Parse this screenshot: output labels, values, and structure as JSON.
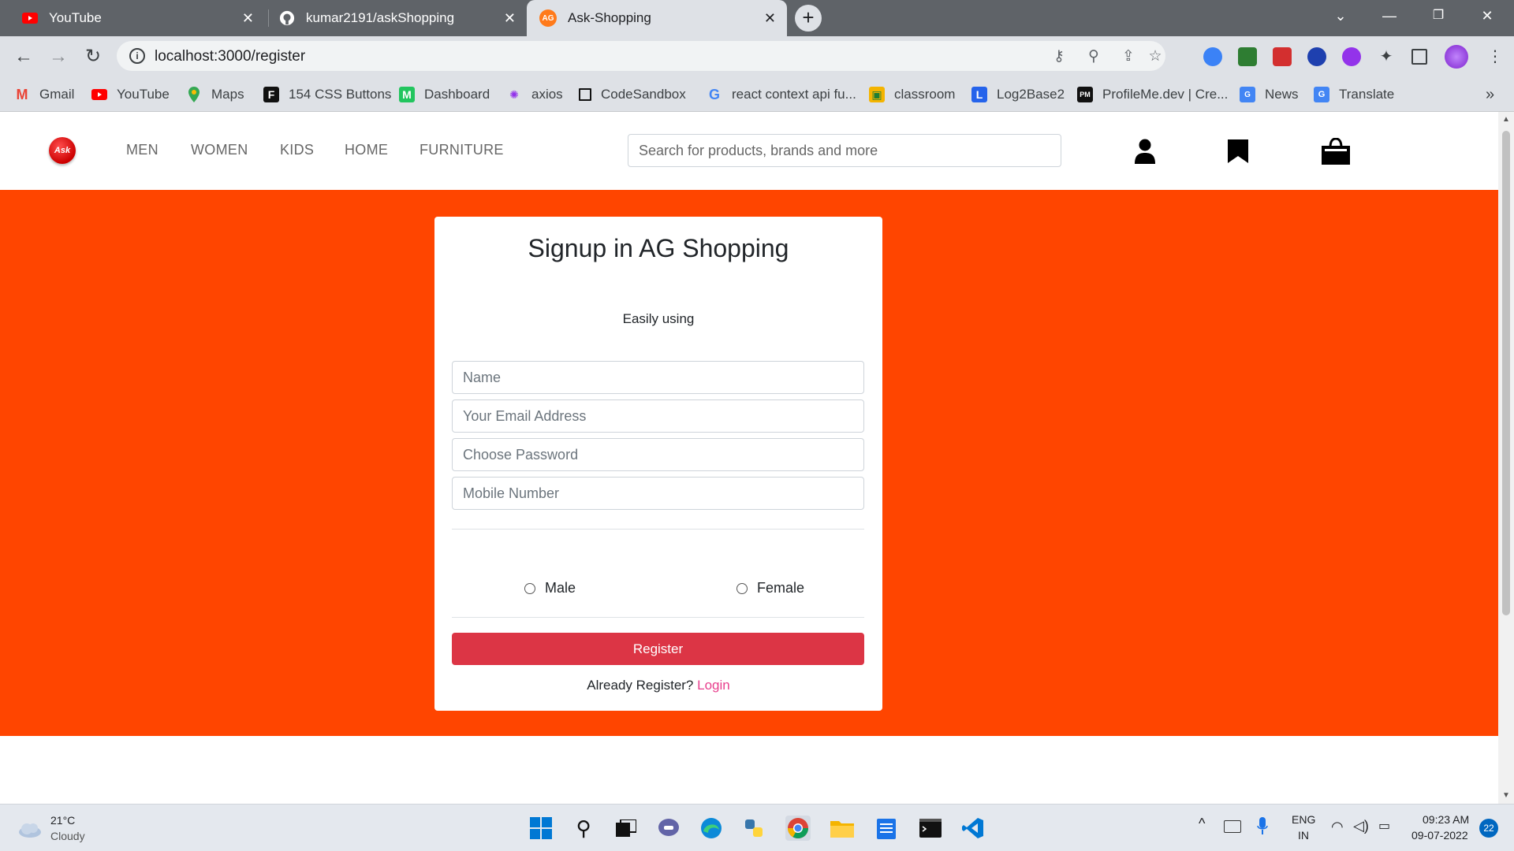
{
  "browser": {
    "tabs": [
      {
        "label": "YouTube",
        "close": "✕"
      },
      {
        "label": "kumar2191/askShopping",
        "close": "✕"
      },
      {
        "label": "Ask-Shopping",
        "close": "✕",
        "favicon": "AG"
      }
    ],
    "new_tab": "+",
    "url": "localhost:3000/register",
    "bookmarks": [
      {
        "label": "Gmail",
        "icon": "gmail-icon"
      },
      {
        "label": "YouTube",
        "icon": "youtube-icon"
      },
      {
        "label": "Maps",
        "icon": "maps-icon"
      },
      {
        "label": "154 CSS Buttons",
        "icon": "f-icon"
      },
      {
        "label": "Dashboard",
        "icon": "m-icon"
      },
      {
        "label": "axios",
        "icon": "axios-icon"
      },
      {
        "label": "CodeSandbox",
        "icon": "codesandbox-icon"
      },
      {
        "label": "react context api fu...",
        "icon": "google-icon"
      },
      {
        "label": "classroom",
        "icon": "classroom-icon"
      },
      {
        "label": "Log2Base2",
        "icon": "log2base2-icon"
      },
      {
        "label": "ProfileMe.dev | Cre...",
        "icon": "profileme-icon"
      },
      {
        "label": "News",
        "icon": "news-icon"
      },
      {
        "label": "Translate",
        "icon": "translate-icon"
      }
    ],
    "more_bookmarks": "»"
  },
  "site": {
    "logo_text": "Ask",
    "nav": [
      "MEN",
      "WOMEN",
      "KIDS",
      "HOME",
      "FURNITURE"
    ],
    "search_placeholder": "Search for products, brands and more",
    "colors": {
      "banner": "#ff4500",
      "register": "#dc3545",
      "login_link": "#e83e8c"
    }
  },
  "signup": {
    "title": "Signup in AG Shopping",
    "subtitle": "Easily using",
    "fields": {
      "name": "Name",
      "email": "Your Email Address",
      "password": "Choose Password",
      "mobile": "Mobile Number"
    },
    "gender": {
      "male": "Male",
      "female": "Female"
    },
    "register_label": "Register",
    "already_text": "Already Register?",
    "login_label": "Login"
  },
  "taskbar": {
    "weather_temp": "21°C",
    "weather_desc": "Cloudy",
    "lang_top": "ENG",
    "lang_bottom": "IN",
    "time": "09:23 AM",
    "date": "09-07-2022",
    "notification_count": "22"
  }
}
